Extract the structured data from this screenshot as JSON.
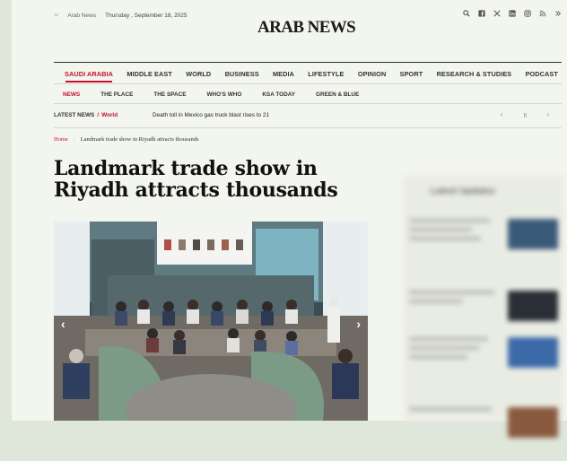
{
  "top": {
    "edition": "Arab News",
    "date": "Thursday , September 18, 2025"
  },
  "brand": {
    "logo": "ARAB NEWS"
  },
  "socials": [
    "search-icon",
    "facebook-icon",
    "x-icon",
    "linkedin-icon",
    "instagram-icon",
    "rss-icon",
    "more-icon"
  ],
  "nav_primary": [
    "SAUDI ARABIA",
    "MIDDLE EAST",
    "WORLD",
    "BUSINESS",
    "MEDIA",
    "LIFESTYLE",
    "OPINION",
    "SPORT",
    "RESEARCH & STUDIES",
    "PODCAST"
  ],
  "nav_secondary": [
    "NEWS",
    "THE PLACE",
    "THE SPACE",
    "WHO'S WHO",
    "KSA TODAY",
    "GREEN & BLUE"
  ],
  "ticker": {
    "label": "LATEST NEWS",
    "slash": "/",
    "category": "World",
    "headline": "Death toll in Mexico gas truck blast rises to 21",
    "prev": "‹",
    "pause": "॥",
    "next": "›"
  },
  "breadcrumb": {
    "home": "Home",
    "sep": "/",
    "current": "Landmark trade show in Riyadh attracts thousands"
  },
  "article": {
    "title": "Landmark trade show in Riyadh attracts thousands"
  },
  "hero": {
    "prev": "‹",
    "next": "›"
  },
  "sidebar": {
    "title": "Latest Updates"
  },
  "colors": {
    "accent": "#c8102e",
    "page_bg": "#f3f5ef",
    "outer_bg": "#dfe6da"
  }
}
